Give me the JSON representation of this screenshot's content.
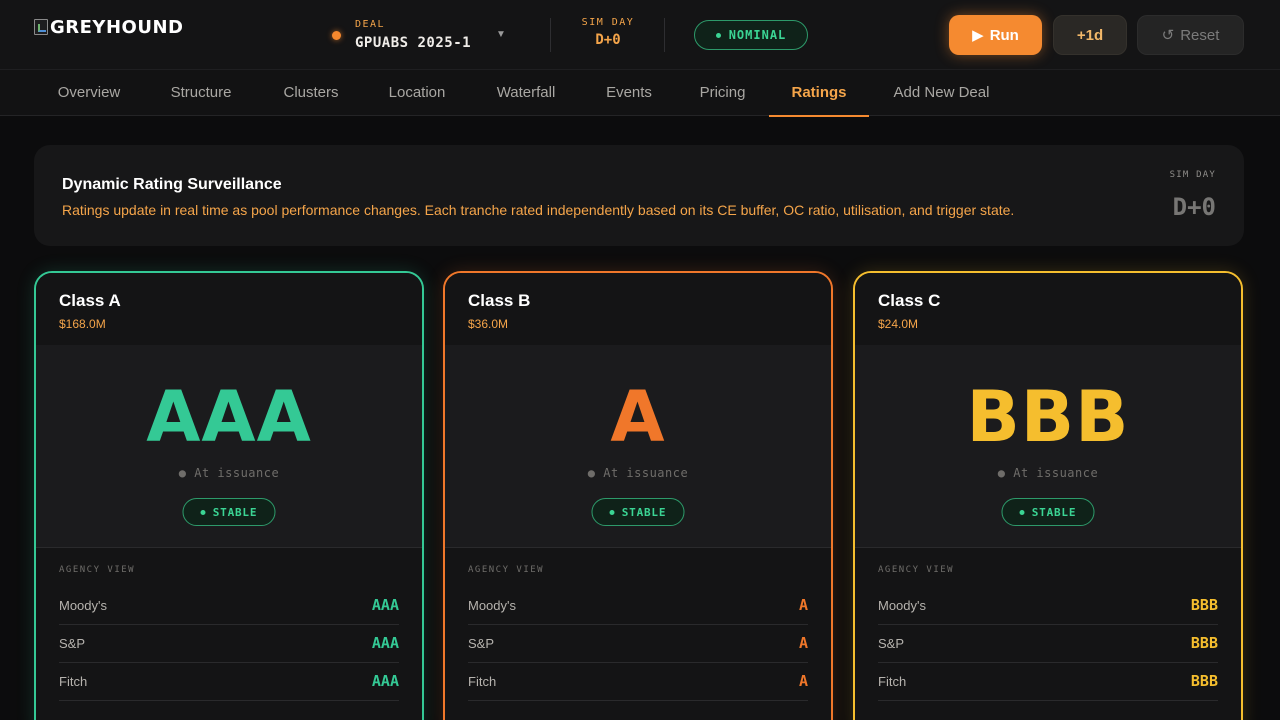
{
  "header": {
    "logo_text": "GREYHOUND",
    "deal_label": "DEAL",
    "deal_value": "GPUABS 2025-1",
    "sim_day_label": "SIM DAY",
    "sim_day_value": "D+0",
    "status": "NOMINAL",
    "run_label": "Run",
    "step_label": "+1d",
    "reset_label": "Reset"
  },
  "tabs": [
    {
      "label": "Overview"
    },
    {
      "label": "Structure"
    },
    {
      "label": "Clusters"
    },
    {
      "label": "Location"
    },
    {
      "label": "Waterfall"
    },
    {
      "label": "Events"
    },
    {
      "label": "Pricing"
    },
    {
      "label": "Ratings",
      "active": true
    },
    {
      "label": "Add New Deal"
    }
  ],
  "banner": {
    "title": "Dynamic Rating Surveillance",
    "description": "Ratings update in real time as pool performance changes. Each tranche rated independently based on its CE buffer, OC ratio, utilisation, and trigger state.",
    "sim_day_label": "SIM DAY",
    "sim_day_value": "D+0"
  },
  "cards": [
    {
      "name": "Class A",
      "amount": "$168.0M",
      "rating": "AAA",
      "at_issuance": "● At issuance",
      "outlook": "STABLE",
      "agency_label": "AGENCY VIEW",
      "agencies": [
        {
          "name": "Moody's",
          "rating": "AAA"
        },
        {
          "name": "S&P",
          "rating": "AAA"
        },
        {
          "name": "Fitch",
          "rating": "AAA"
        }
      ],
      "color": "#34c995"
    },
    {
      "name": "Class B",
      "amount": "$36.0M",
      "rating": "A",
      "at_issuance": "● At issuance",
      "outlook": "STABLE",
      "agency_label": "AGENCY VIEW",
      "agencies": [
        {
          "name": "Moody's",
          "rating": "A"
        },
        {
          "name": "S&P",
          "rating": "A"
        },
        {
          "name": "Fitch",
          "rating": "A"
        }
      ],
      "color": "#f0772a"
    },
    {
      "name": "Class C",
      "amount": "$24.0M",
      "rating": "BBB",
      "at_issuance": "● At issuance",
      "outlook": "STABLE",
      "agency_label": "AGENCY VIEW",
      "agencies": [
        {
          "name": "Moody's",
          "rating": "BBB"
        },
        {
          "name": "S&P",
          "rating": "BBB"
        },
        {
          "name": "Fitch",
          "rating": "BBB"
        }
      ],
      "color": "#f5be2e"
    }
  ],
  "colors": {
    "accent": "#f58a30",
    "status_green": "#3bd494",
    "background": "#0c0c0d"
  }
}
